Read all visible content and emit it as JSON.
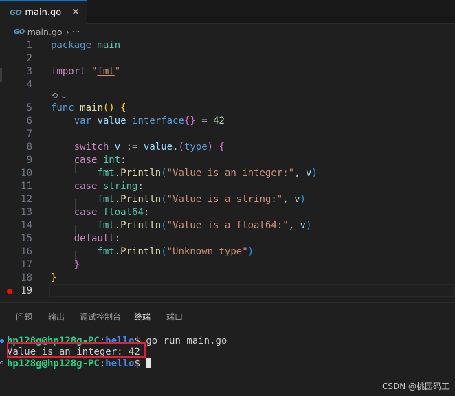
{
  "tab": {
    "icon": "go-file-icon",
    "label": "main.go",
    "close": "✕"
  },
  "breadcrumb": {
    "file": "main.go",
    "sep": "›",
    "more": "···"
  },
  "codelens": {
    "icon": "⟲",
    "chevron": "⌄"
  },
  "editor": {
    "line_numbers": [
      "1",
      "2",
      "3",
      "4",
      "5",
      "6",
      "7",
      "8",
      "9",
      "10",
      "11",
      "12",
      "13",
      "14",
      "15",
      "16",
      "17",
      "18",
      "19"
    ],
    "code": {
      "l1": {
        "kw": "package",
        "name": "main"
      },
      "l3": {
        "kw": "import",
        "q1": "\"",
        "pkg": "fmt",
        "q2": "\""
      },
      "l5": {
        "kw": "func",
        "name": "main",
        "paren": "()",
        "brace": "{"
      },
      "l6": {
        "kw": "var",
        "name": "value",
        "type": "interface",
        "braces": "{}",
        "op": "=",
        "num": "42"
      },
      "l8": {
        "kw": "switch",
        "var": "v",
        "op": ":=",
        "target": "value",
        "dot": ".",
        "lp": "(",
        "type": "type",
        "rp": ")",
        "brace": "{"
      },
      "l9": {
        "kw": "case",
        "type": "int",
        "colon": ":"
      },
      "l10": {
        "pkg": "fmt",
        "dot": ".",
        "fn": "Println",
        "lp": "(",
        "str": "\"Value is an integer:\"",
        "comma": ",",
        "arg": "v",
        "rp": ")"
      },
      "l11": {
        "kw": "case",
        "type": "string",
        "colon": ":"
      },
      "l12": {
        "pkg": "fmt",
        "dot": ".",
        "fn": "Println",
        "lp": "(",
        "str": "\"Value is a string:\"",
        "comma": ",",
        "arg": "v",
        "rp": ")"
      },
      "l13": {
        "kw": "case",
        "type": "float64",
        "colon": ":"
      },
      "l14": {
        "pkg": "fmt",
        "dot": ".",
        "fn": "Println",
        "lp": "(",
        "str": "\"Value is a float64:\"",
        "comma": ",",
        "arg": "v",
        "rp": ")"
      },
      "l15": {
        "kw": "default",
        "colon": ":"
      },
      "l16": {
        "pkg": "fmt",
        "dot": ".",
        "fn": "Println",
        "lp": "(",
        "str": "\"Unknown type\"",
        "rp": ")"
      },
      "l17": {
        "brace": "}"
      },
      "l18": {
        "brace": "}"
      }
    }
  },
  "panel": {
    "tabs": [
      "问题",
      "输出",
      "调试控制台",
      "终端",
      "端口"
    ],
    "active_tab": "终端"
  },
  "terminal": {
    "prompt_user": "hp128g@hp128g-PC",
    "prompt_colon": ":",
    "prompt_path": "hello",
    "prompt_symbol": "$",
    "command": " go run main.go",
    "output": "Value is an integer: 42"
  },
  "watermark": "CSDN @桃园码工",
  "colors": {
    "keyword": "#569cd6",
    "control": "#c586c0",
    "function": "#dcdcaa",
    "variable": "#9cdcfe",
    "type": "#4ec9b0",
    "string": "#ce9178",
    "number": "#b5cea8",
    "highlight": "#e0203a"
  }
}
